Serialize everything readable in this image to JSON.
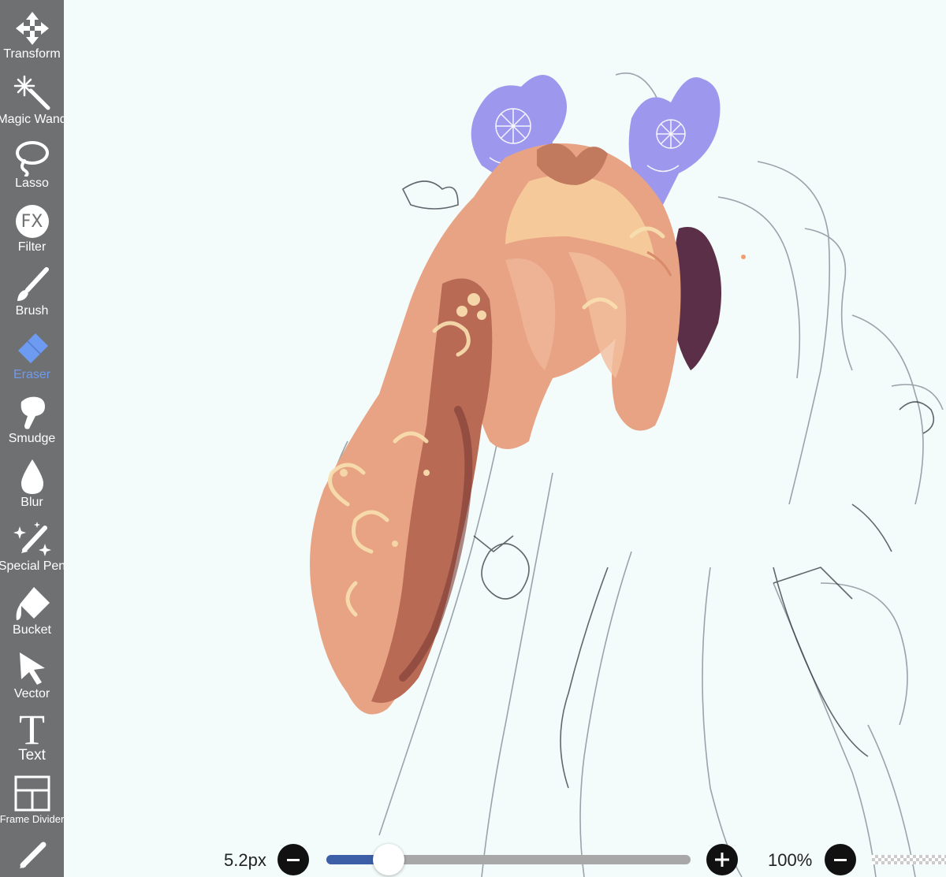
{
  "toolbar": {
    "tools": [
      {
        "id": "transform",
        "label": "Transform",
        "icon": "move-arrows-icon"
      },
      {
        "id": "magic-wand",
        "label": "Magic Wand",
        "icon": "magic-wand-icon"
      },
      {
        "id": "lasso",
        "label": "Lasso",
        "icon": "lasso-icon"
      },
      {
        "id": "filter",
        "label": "Filter",
        "icon": "fx-icon"
      },
      {
        "id": "brush",
        "label": "Brush",
        "icon": "brush-icon"
      },
      {
        "id": "eraser",
        "label": "Eraser",
        "icon": "eraser-icon",
        "active": true
      },
      {
        "id": "smudge",
        "label": "Smudge",
        "icon": "smudge-icon"
      },
      {
        "id": "blur",
        "label": "Blur",
        "icon": "blur-drop-icon"
      },
      {
        "id": "special-pen",
        "label": "Special Pen",
        "icon": "special-pen-icon"
      },
      {
        "id": "bucket",
        "label": "Bucket",
        "icon": "bucket-icon"
      },
      {
        "id": "vector",
        "label": "Vector",
        "icon": "vector-arrow-icon"
      },
      {
        "id": "text",
        "label": "Text",
        "icon": "text-icon"
      },
      {
        "id": "frame-divider",
        "label": "Frame Divider",
        "icon": "frame-divider-icon"
      }
    ],
    "fx_glyph": "FX",
    "text_glyph": "T"
  },
  "brush_controls": {
    "size_label": "5.2px",
    "size_slider_value": 0.17,
    "opacity_label": "100%"
  },
  "colors": {
    "toolbar_bg": "#6f7071",
    "active_tool": "#6e9bf2",
    "canvas_bg": "#f3fbfb",
    "slider_fill": "#3d5fa8",
    "slider_track": "#a8a8a8"
  }
}
